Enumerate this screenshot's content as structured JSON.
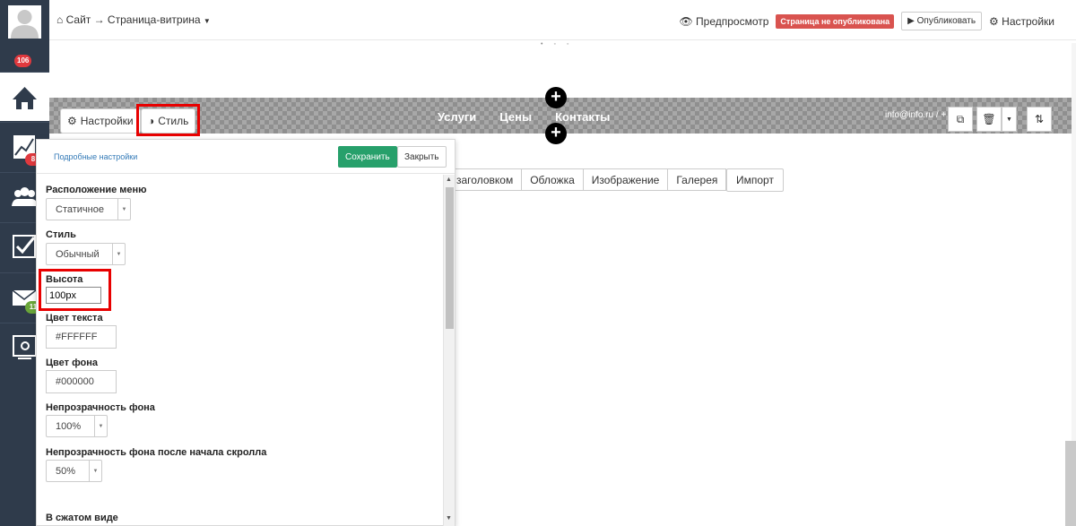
{
  "sidebar": {
    "avatar_icon": "user-avatar-icon",
    "badge_count": "106",
    "items": [
      {
        "icon": "home-icon",
        "badge": ""
      },
      {
        "icon": "chart-icon",
        "badge": "8"
      },
      {
        "icon": "users-icon",
        "badge": ""
      },
      {
        "icon": "checkbox-icon",
        "badge": ""
      },
      {
        "icon": "mail-icon",
        "badge": "11"
      },
      {
        "icon": "settings-monitor-icon",
        "badge": ""
      }
    ]
  },
  "header": {
    "breadcrumb": "Сайт → Страница-витрина",
    "preview": "Предпросмотр",
    "status_badge": "Страница не опубликована",
    "publish": "Опубликовать",
    "settings": "Настройки"
  },
  "block": {
    "nav": [
      "Услуги",
      "Цены",
      "Контакты"
    ],
    "contact": "info@info.ru / +",
    "settings_tab": "Настройки",
    "style_tab": "Стиль"
  },
  "types": [
    "заголовком",
    "Обложка",
    "Изображение",
    "Галерея"
  ],
  "import": "Импорт",
  "panel": {
    "detail_link": "Подробные настройки",
    "save": "Сохранить",
    "close": "Закрыть",
    "menu_position_label": "Расположение меню",
    "menu_position_value": "Статичное",
    "style_label": "Стиль",
    "style_value": "Обычный",
    "height_label": "Высота",
    "height_value": "100px",
    "text_color_label": "Цвет текста",
    "text_color_value": "#FFFFFF",
    "bg_color_label": "Цвет фона",
    "bg_color_value": "#000000",
    "bg_opacity_label": "Непрозрачность фона",
    "bg_opacity_value": "100%",
    "scroll_opacity_label": "Непрозрачность фона после начала скролла",
    "scroll_opacity_value": "50%",
    "collapsed_label": "В сжатом виде"
  },
  "colors": {
    "sidebar": "#2f3b4b",
    "highlight": "#e80000",
    "save": "#27a06b",
    "status": "#d9534f"
  }
}
